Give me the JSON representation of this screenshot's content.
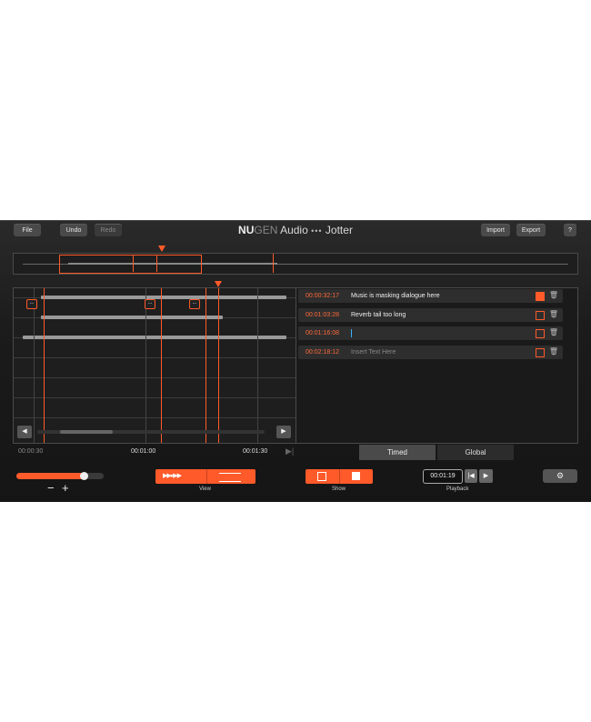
{
  "header": {
    "file_label": "File",
    "undo_label": "Undo",
    "redo_label": "Redo",
    "brand_nu": "NU",
    "brand_gen": "GEN",
    "brand_audio": "Audio",
    "brand_dots": "•••",
    "product": "Jotter",
    "import_label": "Import",
    "export_label": "Export",
    "help_label": "?"
  },
  "notes": [
    {
      "time": "00:00:32:17",
      "text": "Music is masking dialogue here",
      "show": true,
      "placeholder": false
    },
    {
      "time": "00:01:03:28",
      "text": "Reverb tail too long",
      "show": false,
      "placeholder": false
    },
    {
      "time": "00:01:16:08",
      "text": "",
      "show": false,
      "placeholder": false,
      "editing": true
    },
    {
      "time": "00:02:18:12",
      "text": "Insert Text Here",
      "show": false,
      "placeholder": true
    }
  ],
  "timeline": {
    "tick_0": "00:00:30",
    "tick_1": "00:01:00",
    "tick_2": "00:01:30"
  },
  "markers": [
    "...",
    "...",
    "..."
  ],
  "tabs": {
    "timed": "Timed",
    "global": "Global",
    "active": "timed"
  },
  "controls": {
    "zoom_minus": "−",
    "zoom_plus": "+",
    "zoom_level": 0.78,
    "view_label": "View",
    "show_label": "Show",
    "playback_label": "Playback",
    "playback_time": "00:01:19",
    "add_label": "+"
  },
  "colors": {
    "accent": "#ff5a2a",
    "background": "#1b1b1b"
  }
}
